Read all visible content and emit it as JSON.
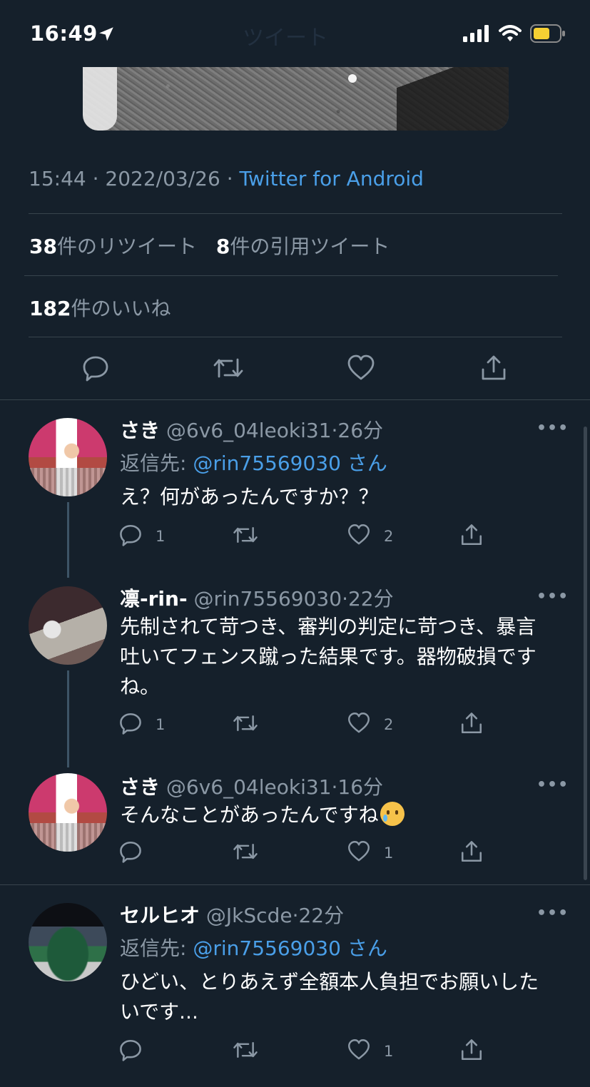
{
  "status_bar": {
    "time": "16:49",
    "header_ghost": "ツイート"
  },
  "tweet": {
    "time": "15:44",
    "date": "2022/03/26",
    "sep": "·",
    "source": "Twitter for Android",
    "retweets_count": "38",
    "retweets_label": "件のリツイート",
    "quotes_count": "8",
    "quotes_label": "件の引用ツイート",
    "likes_count": "182",
    "likes_label": "件のいいね"
  },
  "replies": [
    {
      "name": "さき",
      "handle": "@6v6_04leoki31",
      "time": "26分",
      "reply_to_label": "返信先: ",
      "reply_to_handle": "@rin75569030",
      "reply_to_suffix": "さん",
      "text": "え？何があったんですか？？",
      "reply_count": "1",
      "retweet_count": "",
      "like_count": "2",
      "more": "•••"
    },
    {
      "name": "凛-rin-",
      "handle": "@rin75569030",
      "time": "22分",
      "text": "先制されて苛つき、審判の判定に苛つき、暴言吐いてフェンス蹴った結果です。器物破損ですね。",
      "reply_count": "1",
      "retweet_count": "",
      "like_count": "2",
      "more": "•••"
    },
    {
      "name": "さき",
      "handle": "@6v6_04leoki31",
      "time": "16分",
      "text": "そんなことがあったんですね",
      "emoji_name": "crying-face-emoji",
      "reply_count": "",
      "retweet_count": "",
      "like_count": "1",
      "more": "•••"
    },
    {
      "name": "セルヒオ",
      "handle": "@JkScde",
      "time": "22分",
      "reply_to_label": "返信先: ",
      "reply_to_handle": "@rin75569030",
      "reply_to_suffix": "さん",
      "text": "ひどい、とりあえず全額本人負担でお願いしたいです...",
      "reply_count": "",
      "retweet_count": "",
      "like_count": "1",
      "more": "•••"
    }
  ],
  "colors": {
    "background": "#15202b",
    "accent": "#4a9fe8",
    "muted": "#8b98a5",
    "divider": "#38444d"
  }
}
